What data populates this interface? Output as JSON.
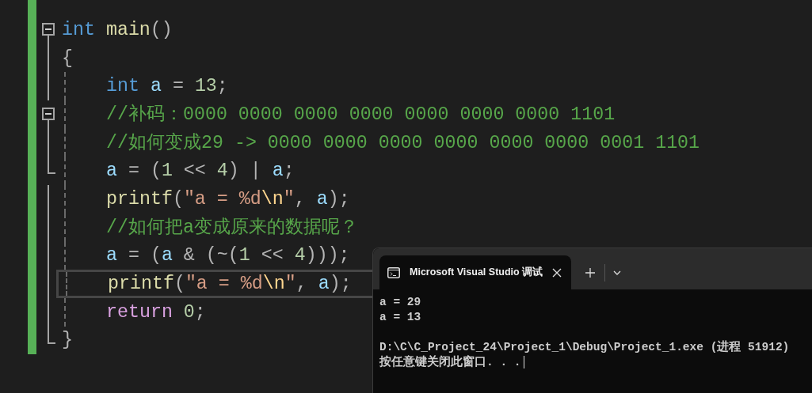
{
  "editor": {
    "lines": [
      {
        "fold_start": true,
        "fold_end": false,
        "indented": false,
        "current": false,
        "tokens": [
          {
            "kind": "keyword",
            "text": "int"
          },
          {
            "kind": "function",
            "text": " main"
          },
          {
            "kind": "punct",
            "text": "()"
          }
        ]
      },
      {
        "fold_start": false,
        "fold_end": false,
        "indented": false,
        "current": false,
        "tokens": [
          {
            "kind": "punct",
            "text": "{"
          }
        ]
      },
      {
        "fold_start": false,
        "fold_end": false,
        "indented": true,
        "current": false,
        "tokens": [
          {
            "kind": "keyword",
            "text": "int"
          },
          {
            "kind": "variable",
            "text": " a"
          },
          {
            "kind": "punct",
            "text": " = "
          },
          {
            "kind": "number",
            "text": "13"
          },
          {
            "kind": "punct",
            "text": ";"
          }
        ]
      },
      {
        "fold_start": true,
        "fold_end": false,
        "indented": true,
        "current": false,
        "tokens": [
          {
            "kind": "comment",
            "text": "//补码：0000 0000 0000 0000 0000 0000 0000 1101"
          }
        ]
      },
      {
        "fold_start": false,
        "fold_end": false,
        "indented": true,
        "current": false,
        "tokens": [
          {
            "kind": "comment",
            "text": "//如何变成29 -> 0000 0000 0000 0000 0000 0000 0001 1101"
          }
        ]
      },
      {
        "fold_start": false,
        "fold_end": true,
        "indented": true,
        "current": false,
        "tokens": [
          {
            "kind": "variable",
            "text": "a"
          },
          {
            "kind": "punct",
            "text": " = ("
          },
          {
            "kind": "number",
            "text": "1"
          },
          {
            "kind": "punct",
            "text": " << "
          },
          {
            "kind": "number",
            "text": "4"
          },
          {
            "kind": "punct",
            "text": ") | "
          },
          {
            "kind": "variable",
            "text": "a"
          },
          {
            "kind": "punct",
            "text": ";"
          }
        ]
      },
      {
        "fold_start": false,
        "fold_end": false,
        "indented": true,
        "current": false,
        "tokens": [
          {
            "kind": "function",
            "text": "printf"
          },
          {
            "kind": "punct",
            "text": "("
          },
          {
            "kind": "string",
            "text": "\"a = %d"
          },
          {
            "kind": "escape",
            "text": "\\n"
          },
          {
            "kind": "string",
            "text": "\""
          },
          {
            "kind": "punct",
            "text": ", "
          },
          {
            "kind": "variable",
            "text": "a"
          },
          {
            "kind": "punct",
            "text": ");"
          }
        ]
      },
      {
        "fold_start": false,
        "fold_end": false,
        "indented": true,
        "current": false,
        "tokens": [
          {
            "kind": "comment",
            "text": "//如何把a变成原来的数据呢？"
          }
        ]
      },
      {
        "fold_start": false,
        "fold_end": false,
        "indented": true,
        "current": false,
        "tokens": [
          {
            "kind": "variable",
            "text": "a"
          },
          {
            "kind": "punct",
            "text": " = ("
          },
          {
            "kind": "variable",
            "text": "a"
          },
          {
            "kind": "punct",
            "text": " & (~("
          },
          {
            "kind": "number",
            "text": "1"
          },
          {
            "kind": "punct",
            "text": " << "
          },
          {
            "kind": "number",
            "text": "4"
          },
          {
            "kind": "punct",
            "text": ")));"
          }
        ]
      },
      {
        "fold_start": false,
        "fold_end": false,
        "indented": true,
        "current": true,
        "tokens": [
          {
            "kind": "function",
            "text": "printf"
          },
          {
            "kind": "punct",
            "text": "("
          },
          {
            "kind": "string",
            "text": "\"a = %d"
          },
          {
            "kind": "escape",
            "text": "\\n"
          },
          {
            "kind": "string",
            "text": "\""
          },
          {
            "kind": "punct",
            "text": ", "
          },
          {
            "kind": "variable",
            "text": "a"
          },
          {
            "kind": "punct",
            "text": ");"
          }
        ]
      },
      {
        "fold_start": false,
        "fold_end": false,
        "indented": true,
        "current": false,
        "tokens": [
          {
            "kind": "control",
            "text": "return"
          },
          {
            "kind": "number",
            "text": " 0"
          },
          {
            "kind": "punct",
            "text": ";"
          }
        ]
      },
      {
        "fold_start": false,
        "fold_end": true,
        "indented": false,
        "current": false,
        "tokens": [
          {
            "kind": "punct",
            "text": "}"
          }
        ]
      }
    ]
  },
  "terminal": {
    "tab": {
      "title": "Microsoft Visual Studio 调试",
      "selected": true
    },
    "output": [
      {
        "text": "a = 29",
        "gap_before": false
      },
      {
        "text": "a = 13",
        "gap_before": false
      },
      {
        "text": "D:\\C\\C_Project_24\\Project_1\\Debug\\Project_1.exe (进程 51912)",
        "gap_before": true
      },
      {
        "text": "按任意键关闭此窗口. . .",
        "gap_before": false
      }
    ]
  }
}
